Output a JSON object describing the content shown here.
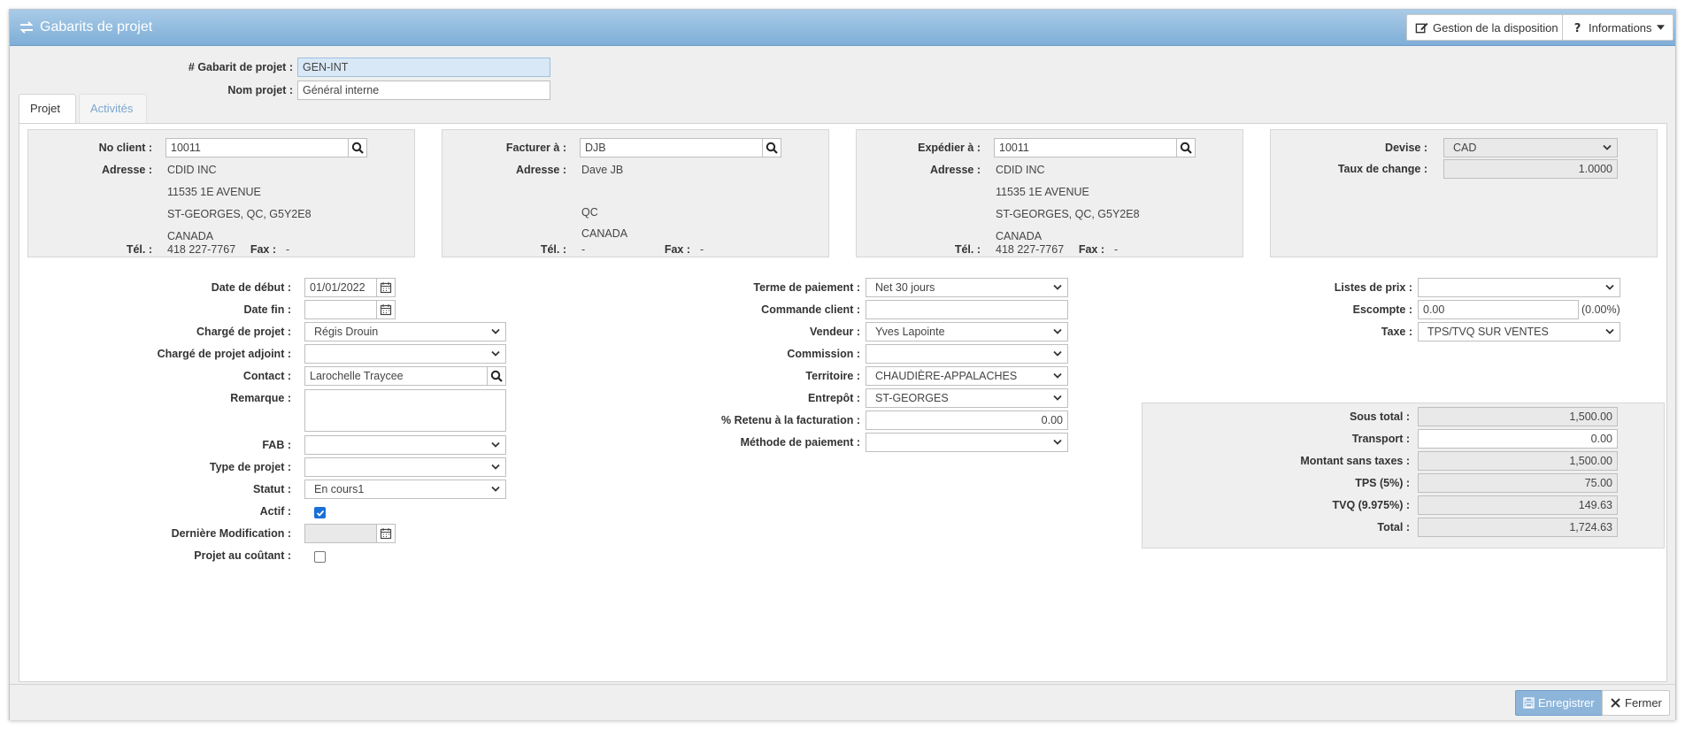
{
  "window": {
    "title": "Gabarits de projet",
    "layout_button": "Gestion de la disposition",
    "info_button": "Informations"
  },
  "header": {
    "template_label": "# Gabarit de projet :",
    "template_value": "GEN-INT",
    "name_label": "Nom projet :",
    "name_value": "Général interne"
  },
  "tabs": [
    {
      "label": "Projet",
      "active": true
    },
    {
      "label": "Activités",
      "active": false
    }
  ],
  "client_card": {
    "client_label": "No client :",
    "client_value": "10011",
    "address_label": "Adresse :",
    "address_lines": [
      "CDID INC",
      "11535 1E AVENUE",
      "ST-GEORGES, QC, G5Y2E8",
      "CANADA"
    ],
    "tel_label": "Tél. :",
    "tel_value": "418 227-7767",
    "fax_label": "Fax :",
    "fax_value": "-"
  },
  "bill_card": {
    "bill_label": "Facturer à :",
    "bill_value": "DJB",
    "address_label": "Adresse :",
    "address_lines": [
      "Dave JB",
      "",
      "QC",
      "CANADA"
    ],
    "tel_label": "Tél. :",
    "tel_value": "-",
    "fax_label": "Fax :",
    "fax_value": "-"
  },
  "ship_card": {
    "ship_label": "Expédier à :",
    "ship_value": "10011",
    "address_label": "Adresse :",
    "address_lines": [
      "CDID INC",
      "11535 1E AVENUE",
      "ST-GEORGES, QC, G5Y2E8",
      "CANADA"
    ],
    "tel_label": "Tél. :",
    "tel_value": "418 227-7767",
    "fax_label": "Fax :",
    "fax_value": "-"
  },
  "currency_card": {
    "currency_label": "Devise :",
    "currency_value": "CAD",
    "rate_label": "Taux de change :",
    "rate_value": "1.0000"
  },
  "left_form": {
    "start_label": "Date de début :",
    "start_value": "01/01/2022",
    "end_label": "Date fin :",
    "end_value": "",
    "manager_label": "Chargé de projet :",
    "manager_value": "Régis Drouin",
    "assistant_label": "Chargé de projet adjoint :",
    "assistant_value": "",
    "contact_label": "Contact :",
    "contact_value": "Larochelle Traycee",
    "remark_label": "Remarque :",
    "fab_label": "FAB :",
    "fab_value": "",
    "type_label": "Type de projet :",
    "type_value": "",
    "status_label": "Statut :",
    "status_value": "En cours1",
    "active_label": "Actif :",
    "active_checked": true,
    "modified_label": "Dernière Modification :",
    "modified_value": "",
    "cost_label": "Projet au coûtant :",
    "cost_checked": false
  },
  "mid_form": {
    "terms_label": "Terme de paiement :",
    "terms_value": "Net 30 jours",
    "order_label": "Commande client :",
    "order_value": "",
    "seller_label": "Vendeur :",
    "seller_value": "Yves Lapointe",
    "commission_label": "Commission :",
    "commission_value": "",
    "territory_label": "Territoire :",
    "territory_value": "CHAUDIÈRE-APPALACHES",
    "warehouse_label": "Entrepôt :",
    "warehouse_value": "ST-GEORGES",
    "retain_label": "% Retenu à la facturation :",
    "retain_value": "0.00",
    "method_label": "Méthode de paiement :",
    "method_value": ""
  },
  "right_form": {
    "pricelist_label": "Listes de prix :",
    "pricelist_value": "",
    "discount_label": "Escompte :",
    "discount_value": "0.00",
    "discount_pct": "(0.00%)",
    "tax_label": "Taxe :",
    "tax_value": "TPS/TVQ SUR VENTES"
  },
  "totals": {
    "subtotal_label": "Sous total :",
    "subtotal_value": "1,500.00",
    "transport_label": "Transport :",
    "transport_value": "0.00",
    "notax_label": "Montant sans taxes :",
    "notax_value": "1,500.00",
    "tps_label": "TPS (5%) :",
    "tps_value": "75.00",
    "tvq_label": "TVQ (9.975%) :",
    "tvq_value": "149.63",
    "total_label": "Total :",
    "total_value": "1,724.63"
  },
  "footer": {
    "save_label": "Enregistrer",
    "close_label": "Fermer"
  }
}
